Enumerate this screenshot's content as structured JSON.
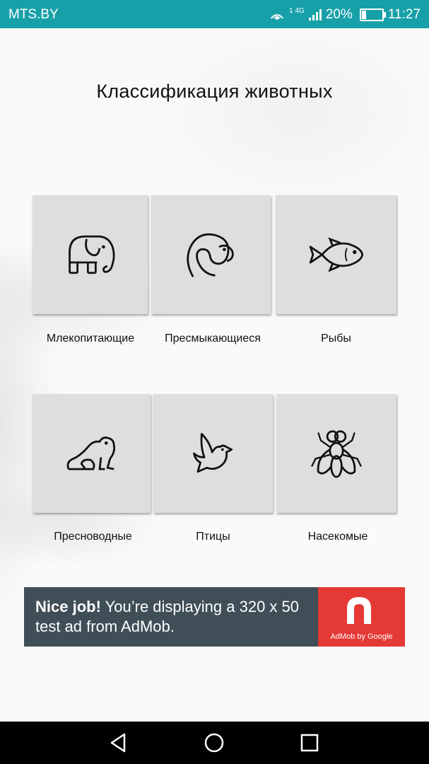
{
  "status_bar": {
    "carrier": "MTS.BY",
    "network_small": "1 4G",
    "battery_percent": "20%",
    "battery_level": 0.2,
    "time": "11:27",
    "icons": [
      "hotspot-icon",
      "signal-icon",
      "battery-charging-icon"
    ]
  },
  "page": {
    "title": "Классификация животных"
  },
  "categories": [
    {
      "label": "Млекопитающие",
      "icon": "elephant-icon"
    },
    {
      "label": "Пресмыкающиеся",
      "icon": "snake-icon"
    },
    {
      "label": "Рыбы",
      "icon": "fish-icon"
    },
    {
      "label": "Пресноводные",
      "icon": "frog-icon"
    },
    {
      "label": "Птицы",
      "icon": "bird-icon"
    },
    {
      "label": "Насекомые",
      "icon": "fly-icon"
    }
  ],
  "ad": {
    "bold": "Nice job!",
    "text": " You’re displaying a 320 x 50 test ad from AdMob.",
    "brand": "AdMob by Google",
    "brand_color": "#e53935",
    "background": "#3f4e57"
  },
  "nav_bar": {
    "icons": [
      "back-icon",
      "home-icon",
      "recents-icon"
    ]
  },
  "colors": {
    "status_bar": "#17a0a8",
    "tile": "#dedede"
  }
}
